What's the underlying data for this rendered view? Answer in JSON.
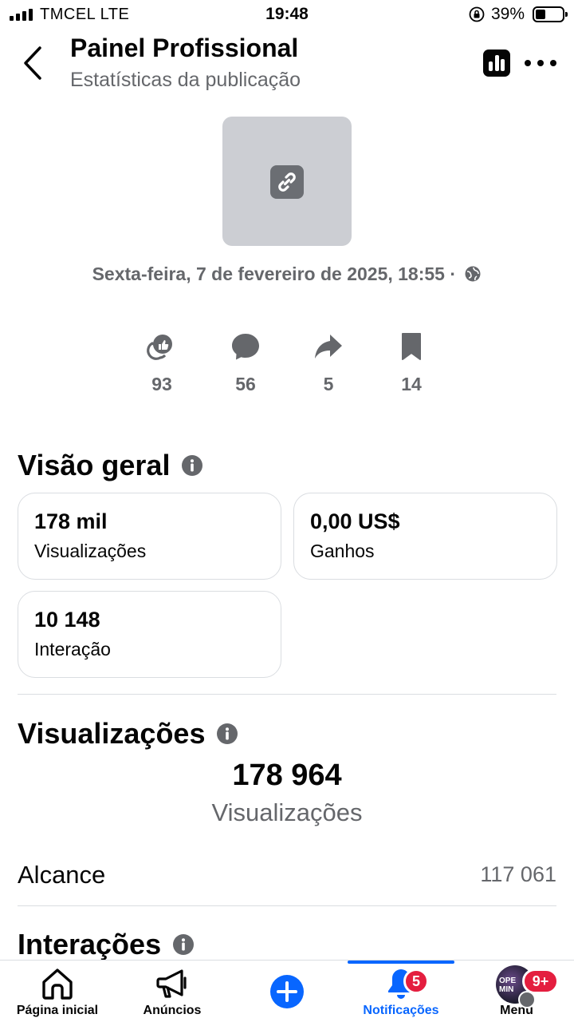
{
  "status_bar": {
    "carrier": "TMCEL  LTE",
    "time": "19:48",
    "battery": "39%"
  },
  "header": {
    "title": "Painel Profissional",
    "subtitle": "Estatísticas da publicação",
    "icons": [
      "back-chevron-icon",
      "insights-chart-icon",
      "more-dots-icon"
    ]
  },
  "post": {
    "thumbnail_icon": "link-icon",
    "date": "Sexta-feira, 7 de fevereiro de 2025, 18:55 ·"
  },
  "reactions": [
    {
      "icon": "reactions-icon",
      "value": "93"
    },
    {
      "icon": "comment-icon",
      "value": "56"
    },
    {
      "icon": "share-icon",
      "value": "5"
    },
    {
      "icon": "bookmark-icon",
      "value": "14"
    }
  ],
  "overview": {
    "title": "Visão geral",
    "cards": [
      {
        "value": "178 mil",
        "label": "Visualizações"
      },
      {
        "value": "0,00 US$",
        "label": "Ganhos"
      },
      {
        "value": "10 148",
        "label": "Interação"
      }
    ]
  },
  "views": {
    "title": "Visualizações",
    "total": "178 964",
    "total_label": "Visualizações",
    "reach_label": "Alcance",
    "reach_value": "117 061"
  },
  "interactions": {
    "title": "Interações"
  },
  "bottom_nav": {
    "items": [
      {
        "label": "Página inicial",
        "icon": "home-icon"
      },
      {
        "label": "Anúncios",
        "icon": "megaphone-icon"
      },
      {
        "label": "",
        "icon": "plus-circle-icon"
      },
      {
        "label": "Notificações",
        "icon": "bell-icon",
        "badge": "5",
        "active": true
      },
      {
        "label": "Menu",
        "icon": "avatar",
        "badge": "9+"
      }
    ]
  },
  "colors": {
    "accent": "#0866ff",
    "text_secondary": "#65676b",
    "badge": "#e41e3f",
    "thumbnail_bg": "#ccced3"
  }
}
